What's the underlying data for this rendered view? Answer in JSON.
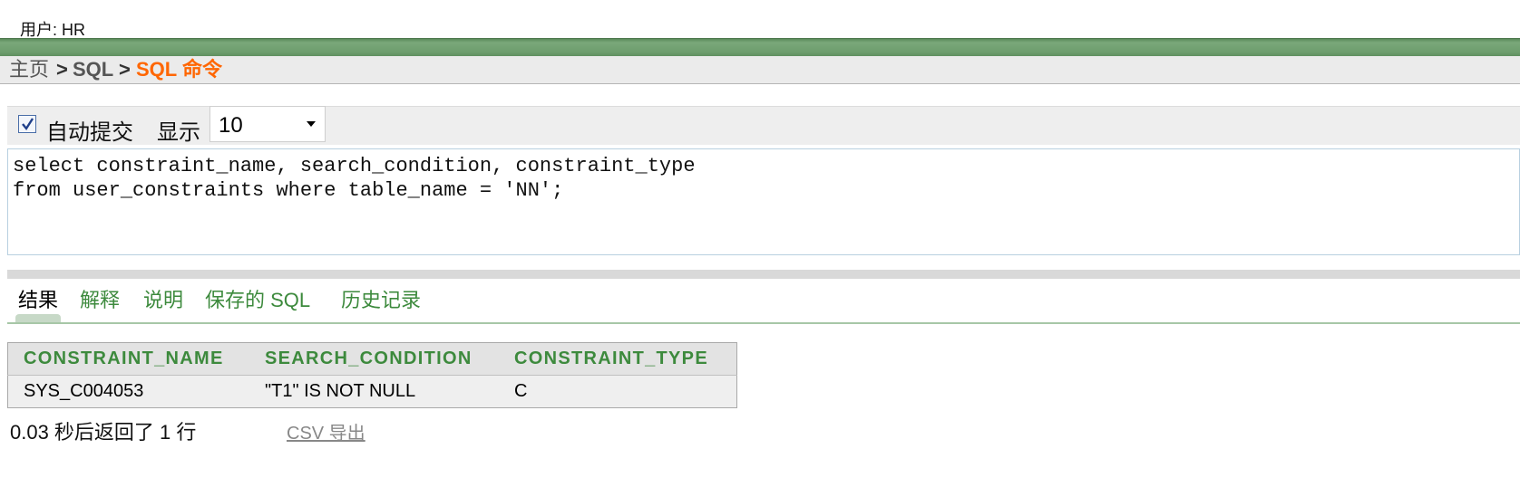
{
  "header": {
    "user_label": "用户: HR"
  },
  "breadcrumb": {
    "home": "主页",
    "separator": ">",
    "sql": "SQL",
    "current": "SQL 命令"
  },
  "toolbar": {
    "autocommit_label": "自动提交",
    "autocommit_checked": true,
    "display_label": "显示",
    "display_value": "10"
  },
  "editor": {
    "lines": [
      "select constraint_name, search_condition, constraint_type",
      "from user_constraints where table_name = 'NN';"
    ]
  },
  "tabs": [
    {
      "label": "结果",
      "active": true
    },
    {
      "label": "解释",
      "active": false
    },
    {
      "label": "说明",
      "active": false
    },
    {
      "label": "保存的 SQL",
      "active": false
    },
    {
      "label": "历史记录",
      "active": false
    }
  ],
  "results": {
    "columns": [
      "CONSTRAINT_NAME",
      "SEARCH_CONDITION",
      "CONSTRAINT_TYPE"
    ],
    "rows": [
      [
        "SYS_C004053",
        "\"T1\" IS NOT NULL",
        "C"
      ]
    ]
  },
  "summary": "0.03 秒后返回了 1 行",
  "csv_export_label": "CSV 导出",
  "colors": {
    "accent_green": "#3d8a3d",
    "breadcrumb_current": "#ff6600",
    "band_green": "#6e9e6e"
  }
}
